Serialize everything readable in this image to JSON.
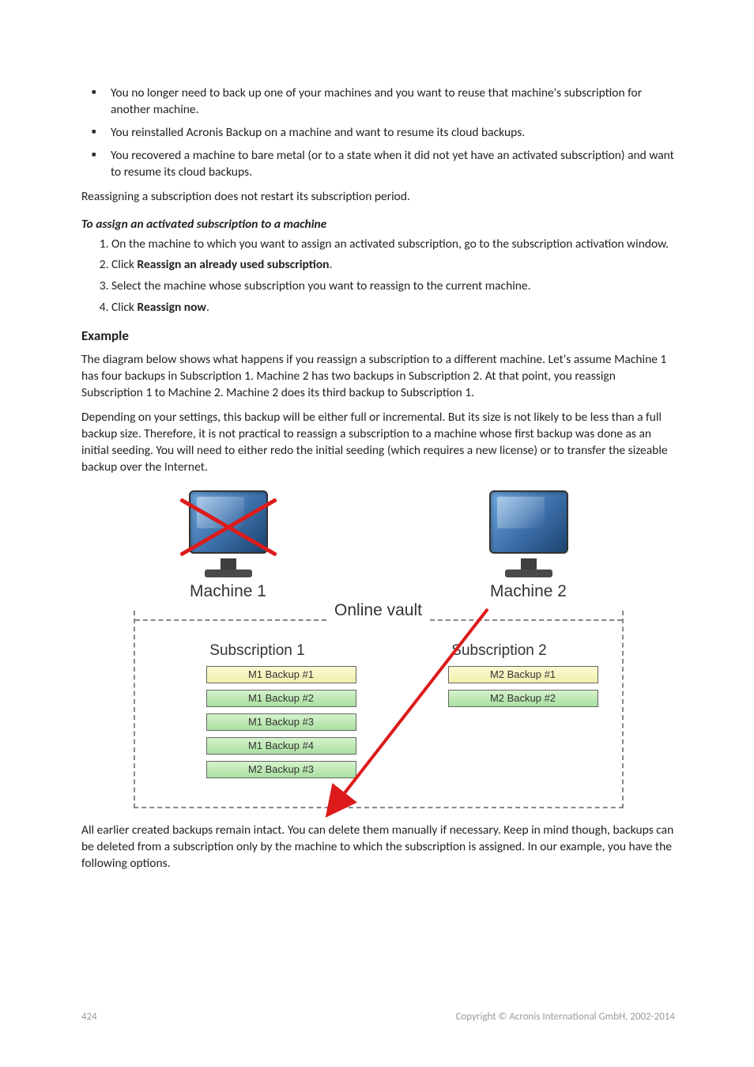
{
  "bullets": [
    "You no longer need to back up one of your machines and you want to reuse that machine's subscription for another machine.",
    "You reinstalled Acronis Backup on a machine and want to resume its cloud backups.",
    "You recovered a machine to bare metal (or to a state when it did not yet have an activated subscription) and want to resume its cloud backups."
  ],
  "para_reassign": "Reassigning a subscription does not restart its subscription period.",
  "subhead": "To assign an activated subscription to a machine",
  "steps": [
    {
      "pre": "On the machine to which you want to assign an activated subscription, go to the subscription activation window."
    },
    {
      "pre": "Click ",
      "bold": "Reassign an already used subscription",
      "post": "."
    },
    {
      "pre": "Select the machine whose subscription you want to reassign to the current machine."
    },
    {
      "pre": "Click ",
      "bold": "Reassign now",
      "post": "."
    }
  ],
  "example_heading": "Example",
  "example_p1": "The diagram below shows what happens if you reassign a subscription to a different machine. Let's assume Machine 1 has four backups in Subscription 1. Machine 2 has two backups in Subscription 2. At that point, you reassign Subscription 1 to Machine 2. Machine 2 does its third backup to Subscription 1.",
  "example_p2": "Depending on your settings, this backup will be either full or incremental. But its size is not likely to be less than a full backup size. Therefore, it is not practical to reassign a subscription to a machine whose first backup was done as an initial seeding. You will need to either redo the initial seeding (which requires a new license) or to transfer the sizeable backup over the Internet.",
  "diagram": {
    "machine1": "Machine 1",
    "machine2": "Machine 2",
    "vault": "Online vault",
    "sub1": "Subscription 1",
    "sub2": "Subscription 2",
    "sub1_backups": [
      "M1 Backup #1",
      "M1 Backup #2",
      "M1 Backup #3",
      "M1 Backup #4",
      "M2 Backup #3"
    ],
    "sub2_backups": [
      "M2 Backup #1",
      "M2 Backup #2"
    ]
  },
  "closing": "All earlier created backups remain intact. You can delete them manually if necessary. Keep in mind though, backups can be deleted from a subscription only by the machine to which the subscription is assigned. In our example, you have the following options.",
  "footer": {
    "page": "424",
    "copyright": "Copyright © Acronis International GmbH, 2002-2014"
  }
}
